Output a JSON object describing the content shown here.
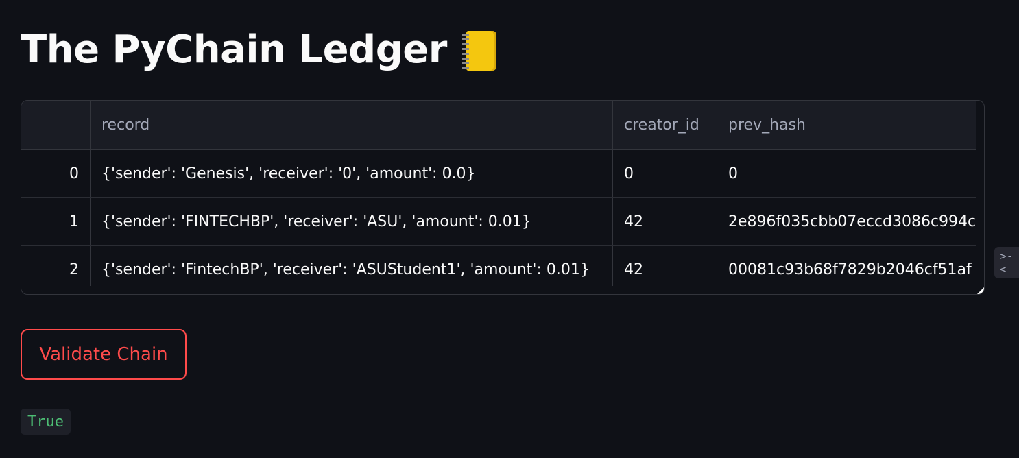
{
  "page": {
    "title": "The PyChain Ledger",
    "title_icon": "ledger-notebook-icon"
  },
  "table": {
    "columns": [
      "",
      "record",
      "creator_id",
      "prev_hash"
    ],
    "rows": [
      {
        "index": "0",
        "record": "{'sender': 'Genesis', 'receiver': '0', 'amount': 0.0}",
        "creator_id": "0",
        "prev_hash": "0"
      },
      {
        "index": "1",
        "record": "{'sender': 'FINTECHBP', 'receiver': 'ASU', 'amount': 0.01}",
        "creator_id": "42",
        "prev_hash": "2e896f035cbb07eccd3086c994c"
      },
      {
        "index": "2",
        "record": "{'sender': 'FintechBP', 'receiver': 'ASUStudent1', 'amount': 0.01}",
        "creator_id": "42",
        "prev_hash": "00081c93b68f7829b2046cf51af"
      }
    ]
  },
  "sidebar_toggle": {
    "label": ">-<",
    "icon": "code-toggle-icon"
  },
  "actions": {
    "validate_label": "Validate Chain"
  },
  "result": {
    "value": "True"
  },
  "colors": {
    "background": "#0f1117",
    "accent": "#ff4b4b",
    "success_text": "#4dbd74"
  }
}
